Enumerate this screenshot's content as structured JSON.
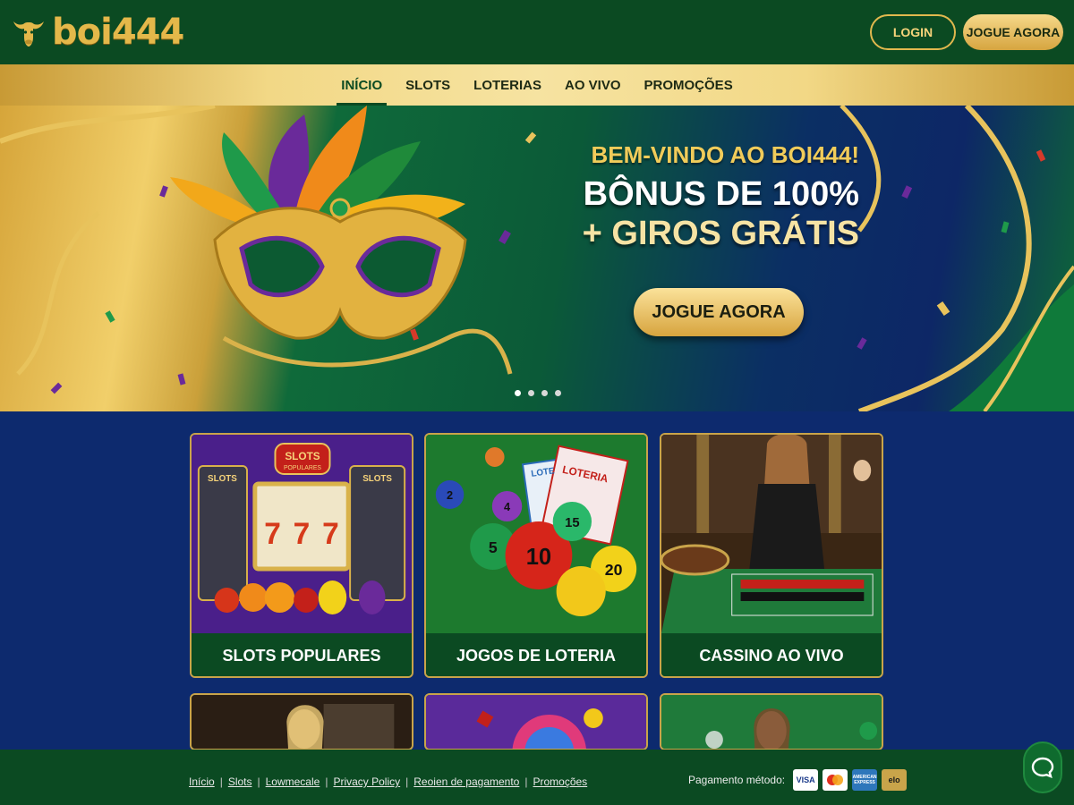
{
  "brand": {
    "name": "boi444"
  },
  "header": {
    "login_label": "LOGIN",
    "play_label": "JOGUE AGORA"
  },
  "nav": {
    "items": [
      "INÍCIO",
      "SLOTS",
      "LOTERIAS",
      "AO VIVO",
      "PROMOÇÕES"
    ],
    "active_index": 0
  },
  "hero": {
    "kicker": "BEM-VINDO AO BOI444!",
    "line1": "BÔNUS DE 100%",
    "line2": "+ GIROS GRÁTIS",
    "cta": "JOGUE AGORA",
    "slides": 4,
    "active_slide": 1
  },
  "cards": [
    {
      "label": "SLOTS POPULARES",
      "image": "slot-machines",
      "art_text": [
        "SLOTS",
        "POPULARES",
        "SLOTS",
        "SLOTS",
        "7",
        "7",
        "7"
      ]
    },
    {
      "label": "JOGOS DE LOTERIA",
      "image": "lottery-balls",
      "art_text": [
        "LOTERIA",
        "LOTE",
        "2",
        "4",
        "5",
        "10",
        "15",
        "20"
      ]
    },
    {
      "label": "CASSINO AO VIVO",
      "image": "live-roulette"
    },
    {
      "label": "",
      "image": "live-dealer"
    },
    {
      "label": "",
      "image": "bingo-balls"
    },
    {
      "label": "",
      "image": "live-dealer-green"
    }
  ],
  "footer": {
    "links": [
      "Início",
      "Slots",
      "Ŀowmecale",
      "Privacy Policy",
      "Reoien de pagamento",
      "Promoções"
    ],
    "payment_label": "Pagamento método:",
    "payment_methods": [
      {
        "name": "VISA",
        "bg": "#ffffff",
        "fg": "#1a3a8a"
      },
      {
        "name": "mastercard",
        "bg": "#ffffff",
        "fg": "#e0301e"
      },
      {
        "name": "AMERICAN EXPRESS",
        "bg": "#2e77bb",
        "fg": "#ffffff"
      },
      {
        "name": "elo",
        "bg": "#c9a44a",
        "fg": "#1a1a1a"
      }
    ]
  },
  "colors": {
    "green": "#0b4a22",
    "gold": "#e1b84e",
    "navy": "#0d2a6e"
  },
  "icons": {
    "chat": "chat-bubble-icon",
    "logo": "bull-head-icon"
  }
}
